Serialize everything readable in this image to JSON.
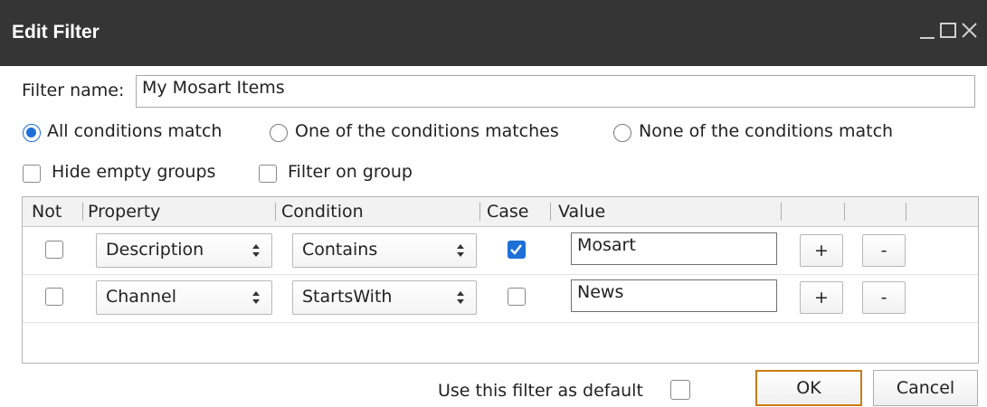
{
  "window": {
    "title": "Edit Filter",
    "controls": {
      "minimize": "_",
      "maximize": "□",
      "close": "✕"
    }
  },
  "filter_name": {
    "label": "Filter name:",
    "value": "My Mosart Items"
  },
  "match_mode": {
    "options": [
      {
        "label": "All conditions match",
        "selected": true
      },
      {
        "label": "One of the conditions matches",
        "selected": false
      },
      {
        "label": "None of the conditions match",
        "selected": false
      }
    ]
  },
  "options": {
    "hide_empty_groups": {
      "label": "Hide empty groups",
      "checked": false
    },
    "filter_on_group": {
      "label": "Filter on group",
      "checked": false
    }
  },
  "grid": {
    "columns": [
      "Not",
      "Property",
      "Condition",
      "Case",
      "Value"
    ],
    "rows": [
      {
        "not": false,
        "property": "Description",
        "condition": "Contains",
        "case": true,
        "value": "Mosart",
        "add": "+",
        "remove": "-"
      },
      {
        "not": false,
        "property": "Channel",
        "condition": "StartsWith",
        "case": false,
        "value": "News",
        "add": "+",
        "remove": "-"
      }
    ]
  },
  "footer": {
    "default_label": "Use this filter as default",
    "default_checked": false,
    "ok_label": "OK",
    "cancel_label": "Cancel"
  },
  "colors": {
    "titlebar": "#353535",
    "accent": "#1e6fd8",
    "default_button_border": "#c97b12"
  }
}
